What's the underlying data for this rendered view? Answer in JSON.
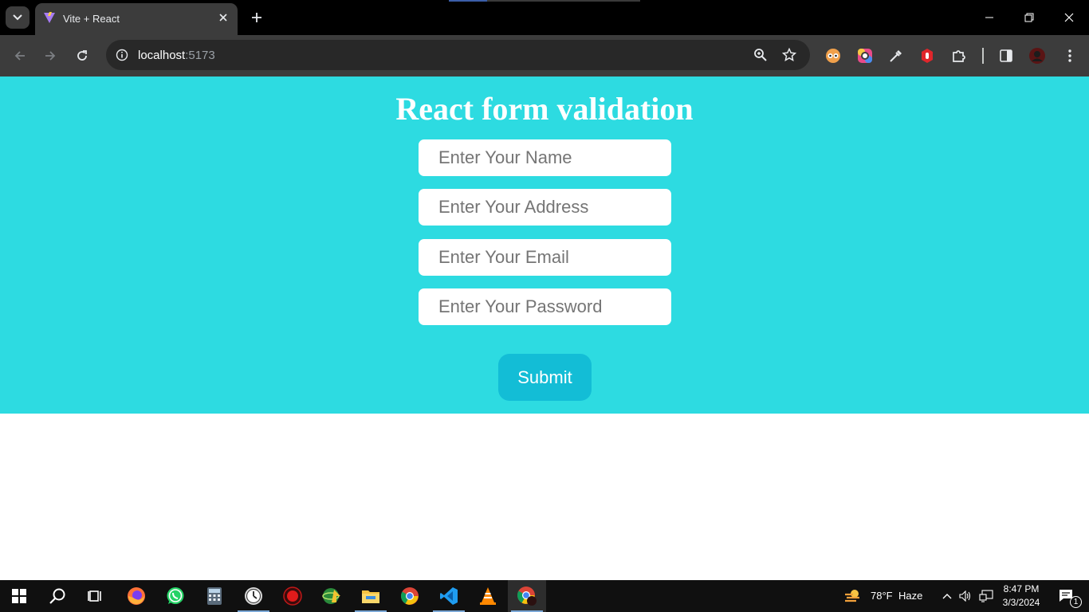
{
  "browser": {
    "tab": {
      "title": "Vite + React"
    },
    "address_bar": {
      "host": "localhost",
      "port": ":5173"
    }
  },
  "page": {
    "title": "React form validation",
    "fields": [
      {
        "placeholder": "Enter Your Name",
        "value": ""
      },
      {
        "placeholder": "Enter Your Address",
        "value": ""
      },
      {
        "placeholder": "Enter Your Email",
        "value": ""
      },
      {
        "placeholder": "Enter Your Password",
        "value": ""
      }
    ],
    "submit_label": "Submit",
    "colors": {
      "form_background": "#2ddbe1",
      "submit_background": "#13bdd6",
      "title_color": "#ffffff"
    }
  },
  "taskbar": {
    "weather": {
      "temp": "78°F",
      "condition": "Haze"
    },
    "clock": {
      "time": "8:47 PM",
      "date": "3/3/2024"
    },
    "notification_count": "1",
    "apps": [
      "start-icon",
      "search-icon",
      "task-view-icon",
      "firefox-icon",
      "whatsapp-icon",
      "calculator-icon",
      "clock-app-icon",
      "record-icon",
      "internet-download-icon",
      "file-explorer-icon",
      "chrome-icon",
      "vscode-icon",
      "vlc-icon",
      "chrome-profile-icon"
    ]
  }
}
